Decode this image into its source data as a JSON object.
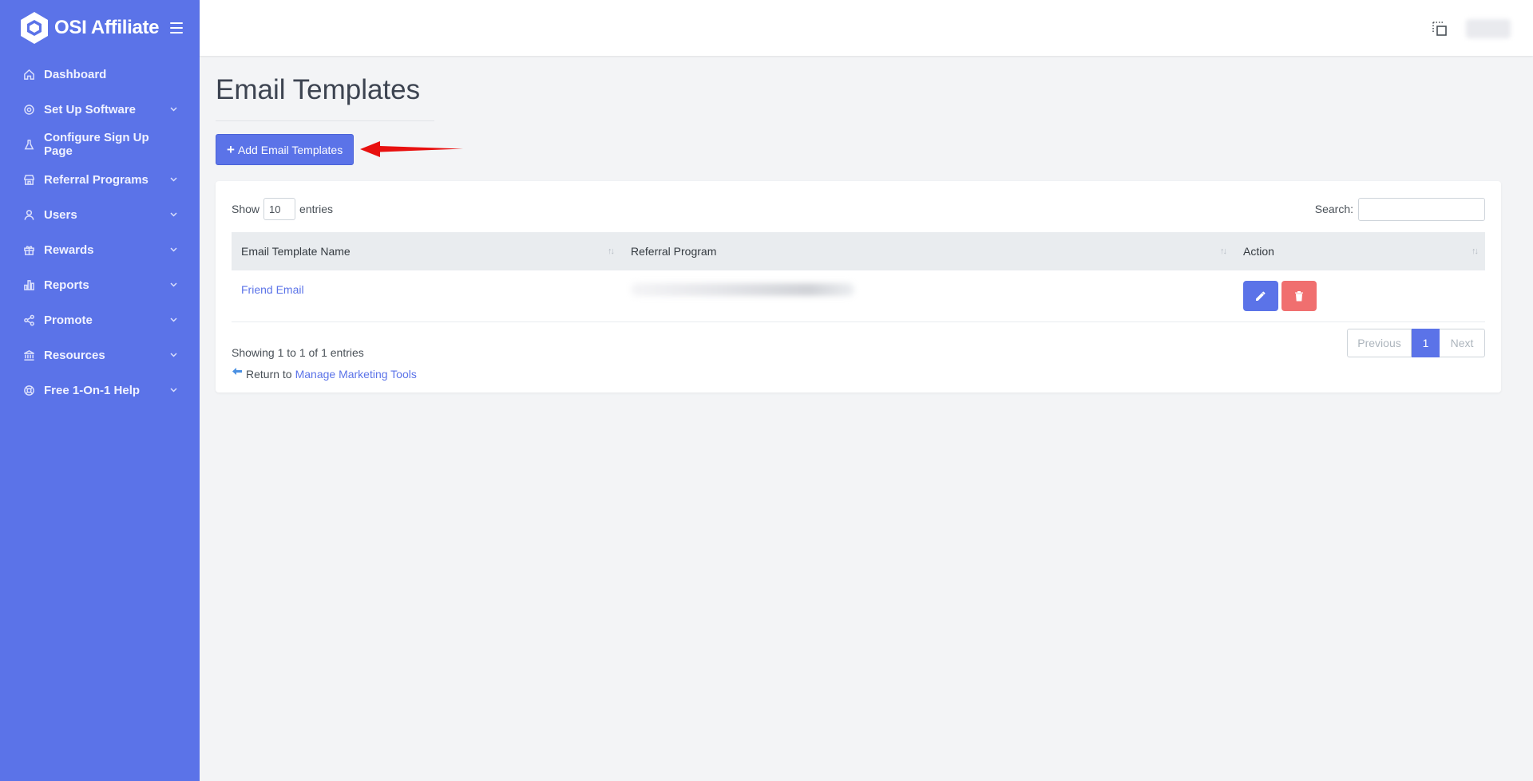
{
  "brand": {
    "name": "OSI Affiliate"
  },
  "sidebar": {
    "items": [
      {
        "label": "Dashboard",
        "icon": "home-icon",
        "expandable": false
      },
      {
        "label": "Set Up Software",
        "icon": "gear-icon",
        "expandable": true
      },
      {
        "label": "Configure Sign Up Page",
        "icon": "flask-icon",
        "expandable": false
      },
      {
        "label": "Referral Programs",
        "icon": "store-icon",
        "expandable": true
      },
      {
        "label": "Users",
        "icon": "user-icon",
        "expandable": true
      },
      {
        "label": "Rewards",
        "icon": "gift-icon",
        "expandable": true
      },
      {
        "label": "Reports",
        "icon": "bar-chart-icon",
        "expandable": true
      },
      {
        "label": "Promote",
        "icon": "share-icon",
        "expandable": true
      },
      {
        "label": "Resources",
        "icon": "bank-icon",
        "expandable": true
      },
      {
        "label": "Free 1-On-1 Help",
        "icon": "lifebuoy-icon",
        "expandable": true
      }
    ]
  },
  "page": {
    "title": "Email Templates",
    "add_button": "Add Email Templates"
  },
  "table_controls": {
    "show_label": "Show",
    "entries_value": "10",
    "entries_label": "entries",
    "search_label": "Search:",
    "search_value": ""
  },
  "table": {
    "columns": [
      "Email Template Name",
      "Referral Program",
      "Action"
    ],
    "rows": [
      {
        "name": "Friend Email",
        "program": ""
      }
    ]
  },
  "footer": {
    "info": "Showing 1 to 1 of 1 entries",
    "return_prefix": "Return to",
    "return_link": "Manage Marketing Tools"
  },
  "pagination": {
    "previous": "Previous",
    "current": "1",
    "next": "Next"
  },
  "colors": {
    "accent": "#5b73e8",
    "danger": "#f06f6f",
    "annotation_arrow": "#e8100f"
  }
}
